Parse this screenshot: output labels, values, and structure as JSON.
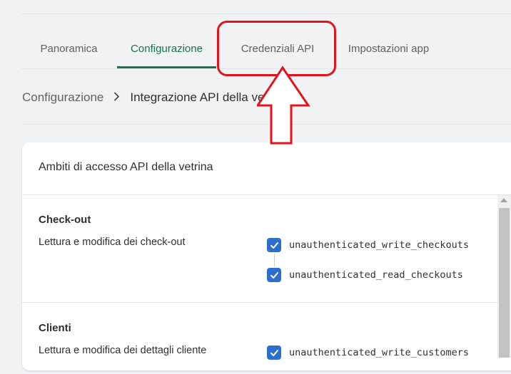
{
  "tabs": [
    {
      "label": "Panoramica",
      "active": false
    },
    {
      "label": "Configurazione",
      "active": true
    },
    {
      "label": "Credenziali API",
      "active": false
    },
    {
      "label": "Impostazioni app",
      "active": false
    }
  ],
  "breadcrumb": {
    "parent": "Configurazione",
    "current": "Integrazione API della vetrina"
  },
  "card": {
    "title": "Ambiti di accesso API della vetrina",
    "sections": [
      {
        "title": "Check-out",
        "description": "Lettura e modifica dei check-out",
        "scopes": [
          {
            "name": "unauthenticated_write_checkouts",
            "checked": true
          },
          {
            "name": "unauthenticated_read_checkouts",
            "checked": true
          }
        ]
      },
      {
        "title": "Clienti",
        "description": "Lettura e modifica dei dettagli cliente",
        "scopes": [
          {
            "name": "unauthenticated_write_customers",
            "checked": true
          }
        ]
      }
    ]
  },
  "colors": {
    "accent": "#1a7251",
    "checkbox": "#2c6ecb",
    "annotation": "#e0141e"
  },
  "icons": {
    "chevron": "chevron-right-icon",
    "check": "checkmark-icon",
    "annotation": "red-up-arrow"
  }
}
